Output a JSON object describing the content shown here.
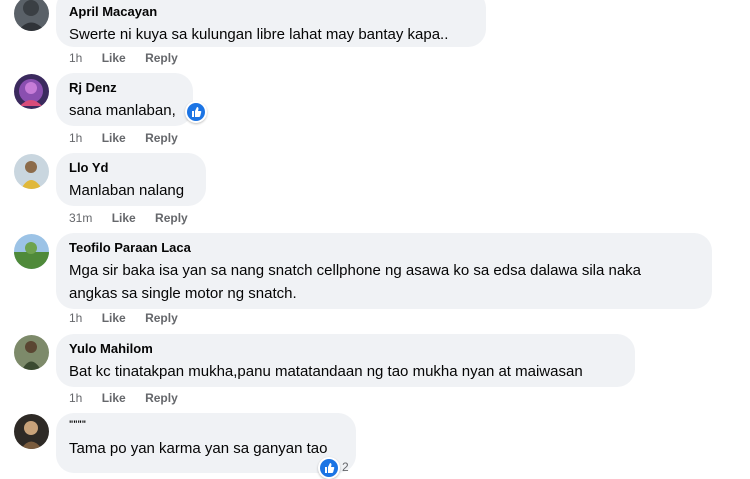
{
  "colors": {
    "bubble_bg": "#f0f2f5",
    "name": "#050505",
    "meta": "#65676b",
    "like_reaction": "#1b74e4"
  },
  "comments": [
    {
      "author": "April Macayan",
      "text": "Swerte ni kuya sa kulungan libre lahat may bantay kapa..",
      "time": "1h",
      "like": "Like",
      "reply": "Reply"
    },
    {
      "author": "Rj Denz",
      "text": "sana manlaban,",
      "time": "1h",
      "like": "Like",
      "reply": "Reply",
      "reaction": "like-icon"
    },
    {
      "author": "Llo Yd",
      "text": "Manlaban nalang",
      "time": "31m",
      "like": "Like",
      "reply": "Reply"
    },
    {
      "author": "Teofilo Paraan Laca",
      "text_line1": "Mga sir baka isa yan sa nang snatch cellphone ng asawa ko sa edsa dalawa sila naka",
      "text_line2": "angkas sa single motor ng snatch.",
      "time": "1h",
      "like": "Like",
      "reply": "Reply"
    },
    {
      "author": "Yulo Mahilom",
      "text": "Bat kc tinatakpan mukha,panu matatandaan ng tao mukha nyan at maiwasan",
      "time": "1h",
      "like": "Like",
      "reply": "Reply"
    },
    {
      "author": "\"\"\"\"",
      "text": "Tama po yan karma yan sa ganyan tao",
      "reaction": "like-icon",
      "reaction_count": "2"
    }
  ]
}
